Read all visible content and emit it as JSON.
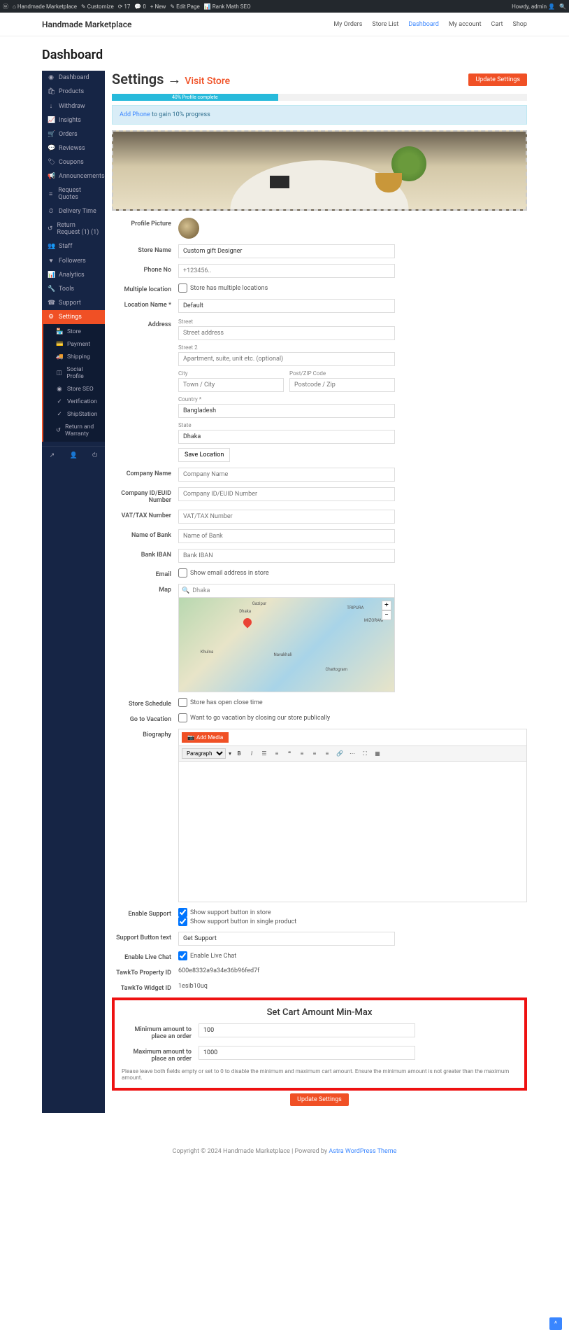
{
  "admin_bar": {
    "site": "Handmade Marketplace",
    "customize": "Customize",
    "updates": "17",
    "comments": "0",
    "new": "New",
    "edit": "Edit Page",
    "rankmath": "Rank Math SEO",
    "howdy": "Howdy, admin"
  },
  "top_nav": {
    "brand": "Handmade Marketplace",
    "items": [
      {
        "label": "My Orders",
        "active": false
      },
      {
        "label": "Store List",
        "active": false
      },
      {
        "label": "Dashboard",
        "active": true
      },
      {
        "label": "My account",
        "active": false
      },
      {
        "label": "Cart",
        "active": false
      },
      {
        "label": "Shop",
        "active": false
      }
    ]
  },
  "page_title": "Dashboard",
  "sidebar": {
    "items": [
      {
        "icon": "◉",
        "label": "Dashboard"
      },
      {
        "icon": "🛍",
        "label": "Products"
      },
      {
        "icon": "↓",
        "label": "Withdraw"
      },
      {
        "icon": "📈",
        "label": "Insights"
      },
      {
        "icon": "🛒",
        "label": "Orders"
      },
      {
        "icon": "💬",
        "label": "Reviewss"
      },
      {
        "icon": "🏷",
        "label": "Coupons"
      },
      {
        "icon": "📢",
        "label": "Announcements"
      },
      {
        "icon": "≡",
        "label": "Request Quotes"
      },
      {
        "icon": "⏱",
        "label": "Delivery Time"
      },
      {
        "icon": "↺",
        "label": "Return Request (1) (1)"
      },
      {
        "icon": "👥",
        "label": "Staff"
      },
      {
        "icon": "♥",
        "label": "Followers"
      },
      {
        "icon": "📊",
        "label": "Analytics"
      },
      {
        "icon": "🔧",
        "label": "Tools"
      },
      {
        "icon": "☎",
        "label": "Support"
      },
      {
        "icon": "⚙",
        "label": "Settings"
      }
    ],
    "subs": [
      {
        "icon": "🏪",
        "label": "Store"
      },
      {
        "icon": "💳",
        "label": "Payment"
      },
      {
        "icon": "🚚",
        "label": "Shipping"
      },
      {
        "icon": "◫",
        "label": "Social Profile"
      },
      {
        "icon": "◉",
        "label": "Store SEO"
      },
      {
        "icon": "✓",
        "label": "Verification"
      },
      {
        "icon": "✓",
        "label": "ShipStation"
      },
      {
        "icon": "↺",
        "label": "Return and Warranty"
      }
    ]
  },
  "main": {
    "heading": "Settings",
    "visit": "Visit Store",
    "update_btn": "Update Settings",
    "progress_text": "40% Profile complete",
    "info_prefix": "Add Phone",
    "info_rest": " to gain 10% progress"
  },
  "form": {
    "profile_picture": "Profile Picture",
    "store_name": {
      "label": "Store Name",
      "value": "Custom gift Designer"
    },
    "phone": {
      "label": "Phone No",
      "placeholder": "+123456.."
    },
    "multi_loc": {
      "label": "Multiple location",
      "text": "Store has multiple locations"
    },
    "loc_name": {
      "label": "Location Name *",
      "value": "Default"
    },
    "address": {
      "label": "Address",
      "street": "Street",
      "street_ph": "Street address",
      "street2": "Street 2",
      "street2_ph": "Apartment, suite, unit etc. (optional)",
      "city": "City",
      "city_ph": "Town / City",
      "zip": "Post/ZIP Code",
      "zip_ph": "Postcode / Zip",
      "country": "Country *",
      "country_val": "Bangladesh",
      "state": "State",
      "state_val": "Dhaka",
      "save_btn": "Save Location"
    },
    "company_name": {
      "label": "Company Name",
      "placeholder": "Company Name"
    },
    "company_id": {
      "label": "Company ID/EUID Number",
      "placeholder": "Company ID/EUID Number"
    },
    "vat": {
      "label": "VAT/TAX Number",
      "placeholder": "VAT/TAX Number"
    },
    "bank": {
      "label": "Name of Bank",
      "placeholder": "Name of Bank"
    },
    "iban": {
      "label": "Bank IBAN",
      "placeholder": "Bank IBAN"
    },
    "email": {
      "label": "Email",
      "text": "Show email address in store"
    },
    "map": {
      "label": "Map",
      "search": "Dhaka",
      "labels": [
        "Dhaka",
        "Gazipur",
        "TRIPURA",
        "MIZORAM",
        "Khulna",
        "Navakhali",
        "Chattogram"
      ]
    },
    "schedule": {
      "label": "Store Schedule",
      "text": "Store has open close time"
    },
    "vacation": {
      "label": "Go to Vacation",
      "text": "Want to go vacation by closing our store publically"
    },
    "bio": {
      "label": "Biography",
      "add_media": "Add Media",
      "paragraph": "Paragraph"
    },
    "support": {
      "label": "Enable Support",
      "text1": "Show support button in store",
      "text2": "Show support button in single product"
    },
    "support_btn": {
      "label": "Support Button text",
      "value": "Get Support"
    },
    "live_chat": {
      "label": "Enable Live Chat",
      "text": "Enable Live Chat"
    },
    "tawk_prop": {
      "label": "TawkTo Property ID",
      "value": "600e8332a9a34e36b96fed7f"
    },
    "tawk_widget": {
      "label": "TawkTo Widget ID",
      "value": "1esib10uq"
    }
  },
  "minmax": {
    "title": "Set Cart Amount Min-Max",
    "min_label": "Minimum amount to place an order",
    "min_val": "100",
    "max_label": "Maximum amount to place an order",
    "max_val": "1000",
    "help": "Please leave both fields empty or set to 0 to disable the minimum and maximum cart amount. Ensure the minimum amount is not greater than the maximum amount."
  },
  "footer": {
    "copy": "Copyright © 2024 Handmade Marketplace | Powered by ",
    "theme": "Astra WordPress Theme"
  }
}
